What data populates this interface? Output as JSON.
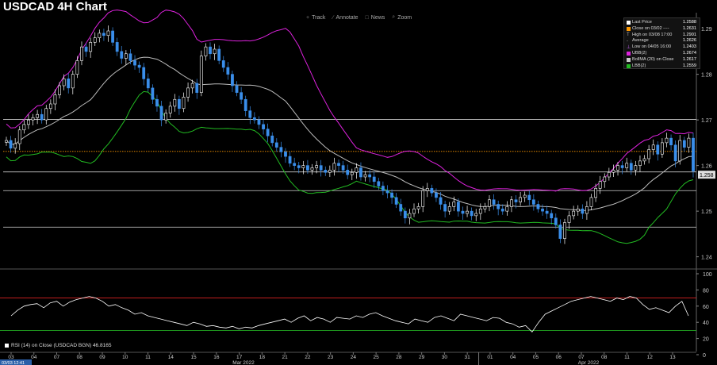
{
  "title": "USDCAD 4H Chart",
  "toolbar": [
    {
      "icon": "track-icon",
      "glyph": "+",
      "label": "Track"
    },
    {
      "icon": "annotate-icon",
      "glyph": "∕",
      "label": "Annotate"
    },
    {
      "icon": "news-icon",
      "glyph": "□",
      "label": "News"
    },
    {
      "icon": "zoom-icon",
      "glyph": "⌕",
      "label": "Zoom"
    }
  ],
  "legend": [
    {
      "label": "Last Price",
      "value": "1.2588",
      "color": "#ffffff",
      "marker": "square"
    },
    {
      "label": "Close on 03/02 ----",
      "value": "1.2631",
      "color": "#ff9900",
      "marker": "square"
    },
    {
      "label": "High on 03/08 17:00",
      "value": "1.2901",
      "color": "#aaaaaa",
      "marker": "T"
    },
    {
      "label": "Average",
      "value": "1.2626",
      "color": "#aaaaaa",
      "marker": "-"
    },
    {
      "label": "Low on 04/05 16:00",
      "value": "1.2403",
      "color": "#cc66ff",
      "marker": "⊥"
    },
    {
      "label": "UBB(2)",
      "value": "1.2674",
      "color": "#dd22dd",
      "marker": "square"
    },
    {
      "label": "BollMA (20)  on Close",
      "value": "1.2617",
      "color": "#cccccc",
      "marker": "square"
    },
    {
      "label": "LBB(2)",
      "value": "1.2559",
      "color": "#22bb22",
      "marker": "square"
    }
  ],
  "price_axis": {
    "ticks": [
      "1.29",
      "1.28",
      "1.27",
      "1.26",
      "1.25",
      "1.24"
    ],
    "last_label": "1.258"
  },
  "rsi_axis": {
    "ticks": [
      "100",
      "80",
      "60",
      "40",
      "20",
      "0"
    ]
  },
  "rsi_label": "RSI (14)  on Close (USDCAD BGN)  46.8165",
  "date_ticks": [
    "03",
    "04",
    "07",
    "08",
    "09",
    "10",
    "11",
    "14",
    "15",
    "16",
    "17",
    "18",
    "21",
    "22",
    "23",
    "24",
    "25",
    "28",
    "29",
    "30",
    "31",
    "01",
    "04",
    "05",
    "06",
    "07",
    "08",
    "11",
    "12",
    "13"
  ],
  "month_labels": [
    "Mar 2022",
    "Apr 2022"
  ],
  "timestamp_box": "03/03 12:41",
  "colors": {
    "up": "#ffffff",
    "down": "#3a8eea",
    "ubb": "#dd22dd",
    "lbb": "#22bb22",
    "ma": "#bbbbbb",
    "close_line": "#ff9900",
    "rsi": "#ffffff",
    "rsi_upper": "#dd2222",
    "rsi_lower": "#22aa22"
  },
  "chart_data": {
    "type": "candlestick",
    "y_range": [
      1.2375,
      1.2935
    ],
    "rsi_range": [
      0,
      100
    ],
    "rsi_levels": [
      70,
      30
    ],
    "horizontal_levels": [
      1.2701,
      1.2631,
      1.2586,
      1.2545,
      1.2465
    ],
    "closes": [
      1.2655,
      1.2638,
      1.2648,
      1.2678,
      1.269,
      1.27,
      1.2705,
      1.2712,
      1.27,
      1.2725,
      1.2735,
      1.2755,
      1.2775,
      1.279,
      1.277,
      1.28,
      1.283,
      1.286,
      1.285,
      1.287,
      1.288,
      1.289,
      1.2885,
      1.2895,
      1.287,
      1.285,
      1.2835,
      1.2845,
      1.283,
      1.282,
      1.2815,
      1.279,
      1.277,
      1.2745,
      1.273,
      1.27,
      1.2715,
      1.273,
      1.2745,
      1.2725,
      1.275,
      1.277,
      1.278,
      1.276,
      1.284,
      1.286,
      1.2845,
      1.2855,
      1.283,
      1.2815,
      1.28,
      1.2775,
      1.276,
      1.2745,
      1.272,
      1.2705,
      1.27,
      1.269,
      1.268,
      1.2665,
      1.265,
      1.264,
      1.263,
      1.262,
      1.2605,
      1.26,
      1.2595,
      1.26,
      1.259,
      1.2595,
      1.26,
      1.259,
      1.2585,
      1.259,
      1.2605,
      1.26,
      1.259,
      1.258,
      1.2585,
      1.2595,
      1.2575,
      1.258,
      1.2575,
      1.2565,
      1.2555,
      1.2545,
      1.254,
      1.253,
      1.2515,
      1.25,
      1.2485,
      1.2495,
      1.2505,
      1.251,
      1.2545,
      1.255,
      1.254,
      1.253,
      1.2515,
      1.25,
      1.251,
      1.252,
      1.25,
      1.2495,
      1.25,
      1.249,
      1.2495,
      1.2505,
      1.251,
      1.2525,
      1.2515,
      1.2505,
      1.25,
      1.251,
      1.2525,
      1.252,
      1.253,
      1.2535,
      1.2525,
      1.2515,
      1.2505,
      1.25,
      1.2495,
      1.2485,
      1.247,
      1.244,
      1.2475,
      1.249,
      1.25,
      1.2505,
      1.2495,
      1.251,
      1.253,
      1.255,
      1.2565,
      1.2575,
      1.2585,
      1.259,
      1.26,
      1.2595,
      1.2605,
      1.259,
      1.26,
      1.261,
      1.2615,
      1.2635,
      1.2645,
      1.2625,
      1.265,
      1.266,
      1.2645,
      1.261,
      1.2655,
      1.264,
      1.266,
      1.2588
    ],
    "rsi_values": [
      48,
      55,
      60,
      62,
      63,
      58,
      64,
      66,
      60,
      65,
      68,
      70,
      72,
      70,
      66,
      60,
      62,
      58,
      55,
      50,
      52,
      48,
      46,
      44,
      42,
      40,
      38,
      36,
      40,
      38,
      35,
      36,
      34,
      33,
      35,
      32,
      34,
      33,
      36,
      38,
      40,
      42,
      44,
      40,
      45,
      48,
      42,
      46,
      44,
      40,
      46,
      45,
      44,
      48,
      46,
      50,
      52,
      48,
      45,
      42,
      40,
      38,
      44,
      42,
      40,
      46,
      48,
      45,
      42,
      50,
      48,
      46,
      44,
      42,
      46,
      45,
      40,
      38,
      34,
      36,
      28,
      40,
      50,
      54,
      58,
      62,
      66,
      68,
      70,
      72,
      70,
      68,
      66,
      70,
      68,
      72,
      70,
      62,
      56,
      58,
      55,
      52,
      60,
      66,
      48
    ]
  }
}
